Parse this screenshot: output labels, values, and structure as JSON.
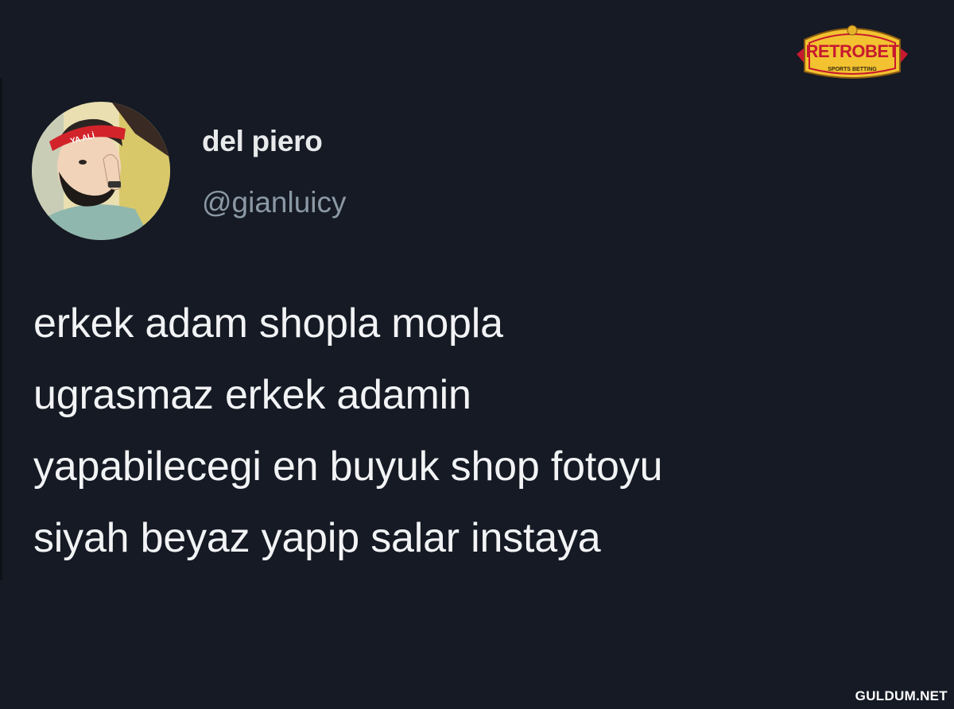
{
  "tweet": {
    "display_name": "del piero",
    "handle": "@gianluicy",
    "text": "erkek adam shopla mopla\nugrasmaz erkek adamin\nyapabilecegi en buyuk shop fotoyu\nsiyah beyaz yapip salar instaya",
    "avatar_icon": "cartoon-profile-avatar"
  },
  "logo": {
    "name": "RETROBET",
    "tagline": "SPORTS BETTING"
  },
  "watermark": "GULDUM.NET",
  "colors": {
    "background": "#151a24",
    "text": "#e7e9ea",
    "handle": "#8b98a5",
    "logo_red": "#c8192f",
    "logo_gold": "#f2c230"
  }
}
